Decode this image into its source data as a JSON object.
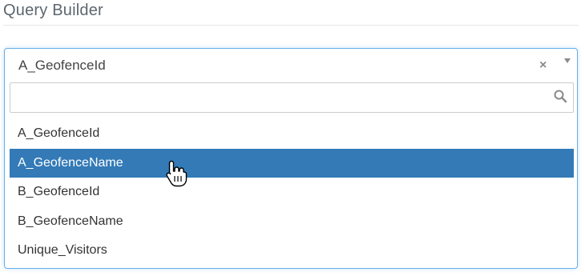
{
  "header": {
    "title": "Query Builder"
  },
  "select": {
    "selected_value": "A_GeofenceId",
    "clear_symbol": "×",
    "search_placeholder": "",
    "search_value": ""
  },
  "options": [
    {
      "label": "A_GeofenceId",
      "highlighted": false
    },
    {
      "label": "A_GeofenceName",
      "highlighted": true
    },
    {
      "label": "B_GeofenceId",
      "highlighted": false
    },
    {
      "label": "B_GeofenceName",
      "highlighted": false
    },
    {
      "label": "Unique_Visitors",
      "highlighted": false
    }
  ],
  "colors": {
    "highlight": "#337ab7",
    "focus_border": "#66afe9",
    "title_text": "#5c6670"
  },
  "icons": {
    "clear": "close-icon",
    "dropdown": "chevron-down-icon",
    "search": "search-icon",
    "cursor": "hand-pointer-icon"
  }
}
